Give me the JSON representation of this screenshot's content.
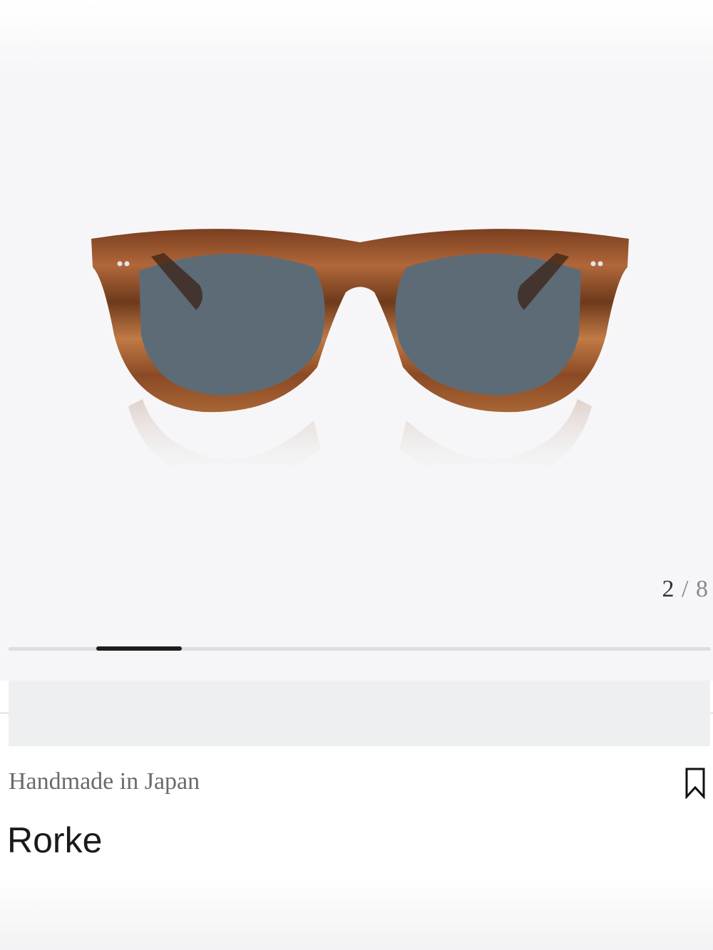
{
  "gallery": {
    "image_alt": "Rorke sunglasses front view",
    "current_index": "2",
    "separator": "/",
    "total": "8",
    "progress_fraction": 0.125
  },
  "product": {
    "origin": "Handmade in Japan",
    "name": "Rorke"
  },
  "icons": {
    "bookmark": "bookmark-icon"
  },
  "colors": {
    "frame_tortoise": "#8a4b26",
    "lens": "#5d6b77",
    "progress_active": "#1d1d1d"
  }
}
